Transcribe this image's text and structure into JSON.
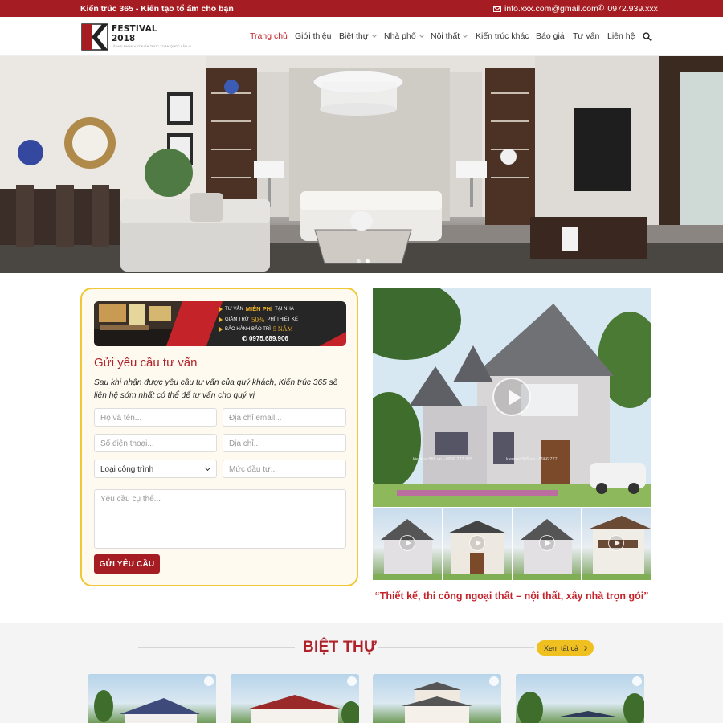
{
  "topbar": {
    "tagline": "Kiến trúc 365 - Kiến tạo tổ ấm cho bạn",
    "email": "info.xxx.com@gmail.com",
    "phone": "0972.939.xxx",
    "email_icon": "mail-icon",
    "phone_icon": "phone-icon"
  },
  "logo": {
    "line1": "FESTIVAL",
    "line2": "2018",
    "line3": "LỄ HỘI NHẬN VẬT KIẾN TRÚC TOÀN QUỐC LẦN III"
  },
  "nav": {
    "items": [
      {
        "label": "Trang chủ",
        "active": true
      },
      {
        "label": "Giới thiệu"
      },
      {
        "label": "Biệt thự",
        "dropdown": true
      },
      {
        "label": "Nhà phố",
        "dropdown": true
      },
      {
        "label": "Nội thất",
        "dropdown": true
      },
      {
        "label": "Kiến trúc khác"
      },
      {
        "label": "Báo giá"
      },
      {
        "label": "Tư vấn"
      },
      {
        "label": "Liên hệ"
      }
    ],
    "search_icon": "search-icon"
  },
  "hero": {
    "slide_count": 2,
    "active_slide": 2
  },
  "banner": {
    "line1_pre": "TƯ VẤN",
    "line1_hl": "MIỄN PHÍ",
    "line1_post": "TẠI NHÀ",
    "line2_pre": "GIẢM TRỪ",
    "line2_hl": "50%",
    "line2_post": "PHÍ THIẾT KẾ",
    "line3_pre": "BẢO HÀNH BẢO TRÌ",
    "line3_hl": "5 NĂM",
    "phone": "0975.689.906"
  },
  "form": {
    "title": "Gửi yêu cầu tư vấn",
    "description": "Sau khi nhận được yêu cầu tư vấn của quý khách, Kiến trúc 365 sẽ liên hệ sớm nhất có thể để tư vấn cho quý vị",
    "name_placeholder": "Họ và tên...",
    "email_placeholder": "Địa chỉ email...",
    "phone_placeholder": "Số điện thoại...",
    "address_placeholder": "Địa chỉ...",
    "type_selected": "Loại công trình",
    "budget_placeholder": "Mức đầu tư...",
    "request_placeholder": "Yêu cầu cụ thể...",
    "submit_label": "GỬI YÊU CẦU"
  },
  "video": {
    "watermark": "kientruc365.vn - 0966.777.965",
    "watermark2": "kientruc365.vn - 0966.777",
    "thumb_count": 4
  },
  "quote": "“Thiết kế, thi công ngoại thất – nội thất, xây nhà trọn gói”",
  "section": {
    "title": "BIỆT THỰ",
    "see_all": "Xem tất cả"
  },
  "colors": {
    "brand_red": "#a51d22",
    "accent_yellow": "#f0c020"
  }
}
